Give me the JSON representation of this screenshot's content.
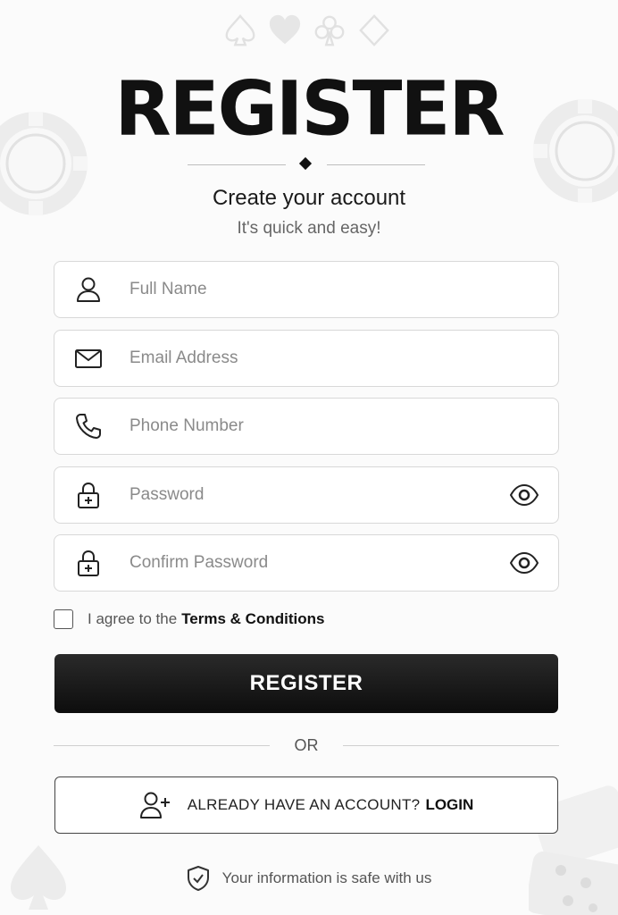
{
  "header": {
    "title": "REGISTER",
    "subtitle": "Create your account",
    "tagline": "It's quick and easy!"
  },
  "form": {
    "full_name": {
      "placeholder": "Full Name",
      "icon": "user-icon",
      "value": ""
    },
    "email": {
      "placeholder": "Email Address",
      "icon": "envelope-icon",
      "value": ""
    },
    "phone": {
      "placeholder": "Phone Number",
      "icon": "phone-icon",
      "value": ""
    },
    "password": {
      "placeholder": "Password",
      "icon": "lock-icon",
      "toggle_icon": "eye-icon",
      "value": ""
    },
    "confirm_password": {
      "placeholder": "Confirm Password",
      "icon": "lock-icon",
      "toggle_icon": "eye-icon",
      "value": ""
    }
  },
  "terms": {
    "prefix": "I agree to the",
    "link": "Terms & Conditions",
    "checked": false
  },
  "register_button": {
    "label": "REGISTER"
  },
  "separator": {
    "label": "OR"
  },
  "login_button": {
    "prefix": "ALREADY HAVE AN ACCOUNT?",
    "link": "LOGIN",
    "icon": "add-user-icon"
  },
  "footer": {
    "safe_text": "Your information is safe with us",
    "icon": "shield-check-icon"
  },
  "colors": {
    "background": "#fbfbfb",
    "primary": "#111111",
    "border": "#d8d8d8",
    "placeholder": "#8a8a8a"
  }
}
